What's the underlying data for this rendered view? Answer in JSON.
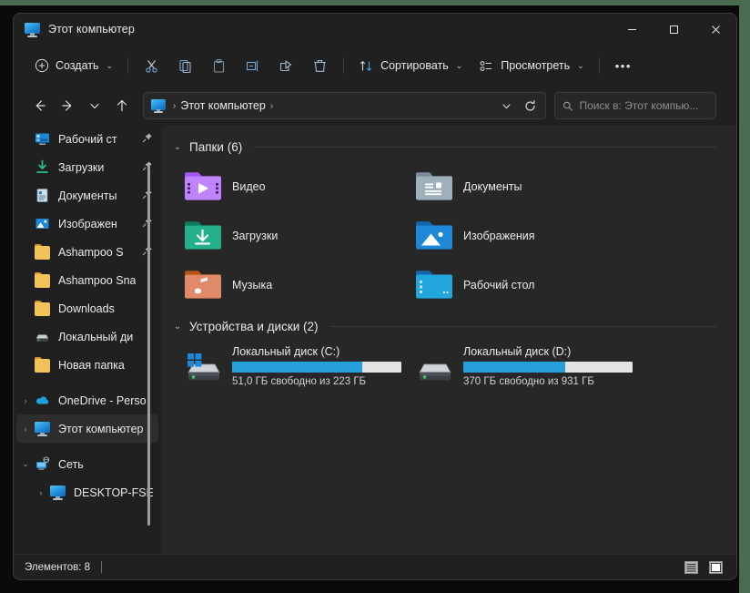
{
  "window": {
    "title": "Этот компьютер",
    "title_icon": "this-pc-icon",
    "controls": {
      "minimize": "—",
      "maximize": "□",
      "close": "✕"
    }
  },
  "toolbar": {
    "new_label": "Создать",
    "sort_label": "Сортировать",
    "view_label": "Просмотреть",
    "more_label": "•••",
    "chevron": "⌄",
    "icon_buttons": [
      {
        "name": "cut-icon",
        "tooltip": "Вырезать"
      },
      {
        "name": "copy-icon",
        "tooltip": "Копировать"
      },
      {
        "name": "paste-icon",
        "tooltip": "Вставить"
      },
      {
        "name": "rename-icon",
        "tooltip": "Переименовать"
      },
      {
        "name": "share-icon",
        "tooltip": "Поделиться"
      },
      {
        "name": "delete-icon",
        "tooltip": "Удалить"
      }
    ]
  },
  "nav": {
    "back": "←",
    "forward": "→",
    "recent": "⌄",
    "up": "↑",
    "breadcrumb": {
      "icon": "this-pc-icon",
      "sep1": "›",
      "label": "Этот компьютер",
      "sep2": "›"
    },
    "address_chevron": "⌄",
    "refresh": "⟳"
  },
  "search": {
    "placeholder": "Поиск в: Этот компью...",
    "value": "",
    "icon": "search-icon"
  },
  "sidebar": {
    "items": [
      {
        "label": "Рабочий ст",
        "icon": "desktop-icon",
        "pinned": true,
        "twisty": "",
        "selected": false
      },
      {
        "label": "Загрузки",
        "icon": "downloads-icon",
        "pinned": true,
        "twisty": "",
        "selected": false
      },
      {
        "label": "Документы",
        "icon": "documents-icon",
        "pinned": true,
        "twisty": "",
        "selected": false
      },
      {
        "label": "Изображен",
        "icon": "pictures-icon",
        "pinned": true,
        "twisty": "",
        "selected": false
      },
      {
        "label": "Ashampoo S",
        "icon": "folder-icon",
        "pinned": true,
        "twisty": "",
        "selected": false
      },
      {
        "label": "Ashampoo Sna",
        "icon": "folder-icon",
        "pinned": false,
        "twisty": "",
        "selected": false
      },
      {
        "label": "Downloads",
        "icon": "folder-icon",
        "pinned": false,
        "twisty": "",
        "selected": false
      },
      {
        "label": "Локальный ди",
        "icon": "drive-icon",
        "pinned": false,
        "twisty": "",
        "selected": false
      },
      {
        "label": "Новая папка",
        "icon": "folder-icon",
        "pinned": false,
        "twisty": "",
        "selected": false
      },
      {
        "label": "OneDrive - Perso",
        "icon": "onedrive-icon",
        "pinned": false,
        "twisty": "›",
        "selected": false
      },
      {
        "label": "Этот компьютер",
        "icon": "this-pc-icon",
        "pinned": false,
        "twisty": "›",
        "selected": true
      },
      {
        "label": "Сеть",
        "icon": "network-icon",
        "pinned": false,
        "twisty": "⌄",
        "selected": false
      },
      {
        "label": "DESKTOP-FSEO",
        "icon": "this-pc-icon",
        "pinned": false,
        "twisty": "›",
        "selected": false,
        "indent": true
      }
    ],
    "pin_glyph": "📌"
  },
  "main": {
    "folders_group": {
      "chevron": "⌄",
      "title": "Папки (6)"
    },
    "folders": [
      {
        "name": "Видео",
        "icon": "videos-folder-icon",
        "color_tab": "#a855f7",
        "color_body": "#c084fc"
      },
      {
        "name": "Документы",
        "icon": "documents-folder-icon",
        "color_tab": "#7d8b99",
        "color_body": "#9fb0bd"
      },
      {
        "name": "Загрузки",
        "icon": "downloads-folder-icon",
        "color_tab": "#0e7a5f",
        "color_body": "#23b08a"
      },
      {
        "name": "Изображения",
        "icon": "pictures-folder-icon",
        "color_tab": "#1565b0",
        "color_body": "#1e88d8"
      },
      {
        "name": "Музыка",
        "icon": "music-folder-icon",
        "color_tab": "#b45309",
        "color_body": "#e08a6a"
      },
      {
        "name": "Рабочий стол",
        "icon": "desktop-folder-icon",
        "color_tab": "#1565b0",
        "color_body": "#22a7dd"
      }
    ],
    "drives_group": {
      "chevron": "⌄",
      "title": "Устройства и диски (2)"
    },
    "drives": [
      {
        "name": "Локальный диск (C:)",
        "free_text": "51,0 ГБ свободно из 223 ГБ",
        "used_percent": 77,
        "has_windows_logo": true,
        "bar_color": "#26a0da"
      },
      {
        "name": "Локальный диск (D:)",
        "free_text": "370 ГБ свободно из 931 ГБ",
        "used_percent": 60,
        "has_windows_logo": false,
        "bar_color": "#26a0da"
      }
    ]
  },
  "status": {
    "items_text": "Элементов: 8",
    "view_buttons": [
      {
        "name": "details-view-button",
        "active": false
      },
      {
        "name": "large-icons-view-button",
        "active": true
      }
    ]
  },
  "colors": {
    "accent": "#26a0da",
    "window_bg": "#202020",
    "content_bg": "#272727",
    "desktop_green": "#4a6b4f"
  }
}
